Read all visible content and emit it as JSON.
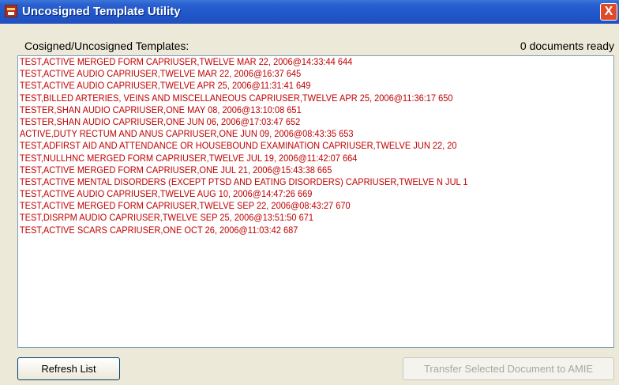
{
  "window": {
    "title": "Uncosigned Template Utility",
    "close_glyph": "X"
  },
  "header": {
    "list_label": "Cosigned/Uncosigned Templates:",
    "ready_status": "0 documents ready"
  },
  "rows": [
    "TEST,ACTIVE   MERGED FORM   CAPRIUSER,TWELVE      MAR 22, 2006@14:33:44   644",
    "TEST,ACTIVE   AUDIO   CAPRIUSER,TWELVE      MAR 22, 2006@16:37   645",
    "TEST,ACTIVE   AUDIO   CAPRIUSER,TWELVE      APR 25, 2006@11:31:41   649",
    "TEST,BILLED   ARTERIES, VEINS AND MISCELLANEOUS   CAPRIUSER,TWELVE      APR 25, 2006@11:36:17   650",
    "TESTER,SHAN   AUDIO   CAPRIUSER,ONE    MAY 08, 2006@13:10:08   651",
    "TESTER,SHAN   AUDIO   CAPRIUSER,ONE    JUN 06, 2006@17:03:47   652",
    "ACTIVE,DUTY   RECTUM AND ANUS CAPRIUSER,ONE         JUN 09, 2006@08:43:35   653",
    "TEST,ADFIRST   AID AND ATTENDANCE OR HOUSEBOUND EXAMINATION   CAPRIUSER,TWELVE      JUN 22, 20",
    "TEST,NULLHNC   MERGED FORM   CAPRIUSER,TWELVE      JUL 19, 2006@11:42:07   664",
    "TEST,ACTIVE   MERGED FORM CAPRIUSER,ONE JUL 21, 2006@15:43:38   665",
    "TEST,ACTIVE   MENTAL DISORDERS (EXCEPT PTSD AND EATING DISORDERS)   CAPRIUSER,TWELVE N   JUL 1",
    "TEST,ACTIVE   AUDIO   CAPRIUSER,TWELVE      AUG 10, 2006@14:47:26   669",
    "TEST,ACTIVE   MERGED FORM   CAPRIUSER,TWELVE      SEP 22, 2006@08:43:27   670",
    "TEST,DISRPM   AUDIO   CAPRIUSER,TWELVE      SEP 25, 2006@13:51:50   671",
    "TEST,ACTIVE   SCARS   CAPRIUSER,ONE   OCT 26, 2006@11:03:42   687"
  ],
  "buttons": {
    "refresh": "Refresh List",
    "transfer": "Transfer Selected Document to AMIE"
  },
  "icons": {
    "app": "template-utility-icon",
    "close": "close-icon"
  },
  "colors": {
    "row_text": "#c00000",
    "titlebar": "#2a5fd0",
    "close": "#e04a2a",
    "face": "#ece9d8"
  }
}
